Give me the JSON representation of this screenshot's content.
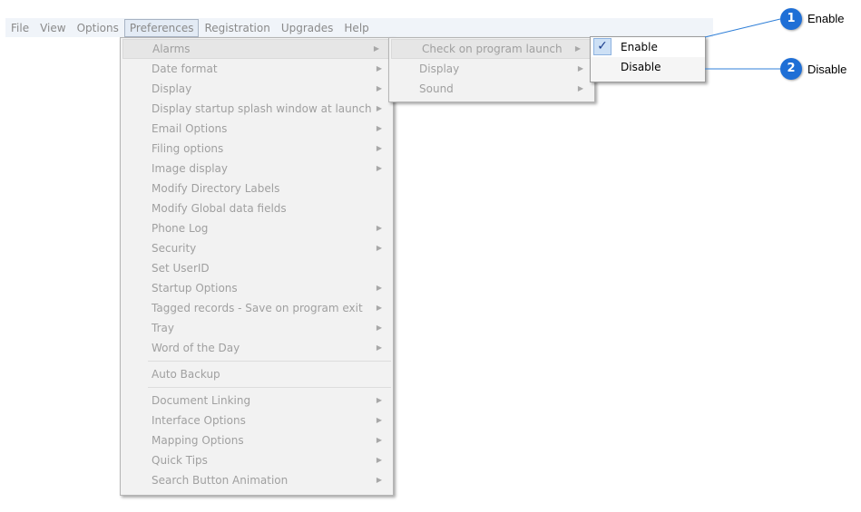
{
  "menubar": {
    "items": [
      "File",
      "View",
      "Options",
      "Preferences",
      "Registration",
      "Upgrades",
      "Help"
    ],
    "active": "Preferences"
  },
  "preferences_menu": {
    "group1": [
      {
        "label": "Alarms",
        "submenu": true
      },
      {
        "label": "Date format",
        "submenu": true
      },
      {
        "label": "Display",
        "submenu": true
      },
      {
        "label": "Display startup splash window at launch",
        "submenu": true
      },
      {
        "label": "Email Options",
        "submenu": true
      },
      {
        "label": "Filing options",
        "submenu": true
      },
      {
        "label": "Image display",
        "submenu": true
      },
      {
        "label": "Modify Directory Labels",
        "submenu": false
      },
      {
        "label": "Modify Global data fields",
        "submenu": false
      },
      {
        "label": "Phone Log",
        "submenu": true
      },
      {
        "label": "Security",
        "submenu": true
      },
      {
        "label": "Set UserID",
        "submenu": false
      },
      {
        "label": "Startup Options",
        "submenu": true
      },
      {
        "label": "Tagged records - Save on program exit",
        "submenu": true
      },
      {
        "label": "Tray",
        "submenu": true
      },
      {
        "label": "Word of the Day",
        "submenu": true
      }
    ],
    "group2": [
      {
        "label": "Auto Backup",
        "submenu": false
      }
    ],
    "group3": [
      {
        "label": "Document Linking",
        "submenu": true
      },
      {
        "label": "Interface Options",
        "submenu": true
      },
      {
        "label": "Mapping Options",
        "submenu": true
      },
      {
        "label": "Quick Tips",
        "submenu": true
      },
      {
        "label": "Search Button Animation",
        "submenu": true
      }
    ]
  },
  "alarms_menu": {
    "items": [
      {
        "label": "Check on program launch",
        "submenu": true
      },
      {
        "label": "Display",
        "submenu": true
      },
      {
        "label": "Sound",
        "submenu": true
      }
    ]
  },
  "launch_menu": {
    "items": [
      {
        "label": "Enable",
        "checked": true
      },
      {
        "label": "Disable",
        "checked": false
      }
    ],
    "check_glyph": "✓"
  },
  "callouts": [
    {
      "number": "1",
      "label": "Enable"
    },
    {
      "number": "2",
      "label": "Disable"
    }
  ],
  "colors": {
    "badge": "#1f6fd6",
    "callout_line": "#2f7fd8",
    "check_bg": "#cde0f5"
  },
  "icons": {
    "submenu_arrow": "▶"
  }
}
